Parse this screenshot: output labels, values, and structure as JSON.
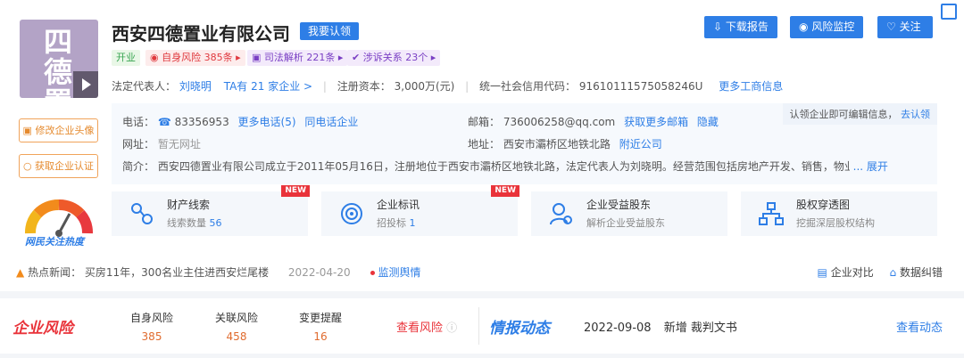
{
  "company": {
    "logo_text": "四德置业",
    "name": "西安四德置业有限公司",
    "claim_button": "我要认领",
    "status_tag": "开业",
    "risk_tag": "自身风险 385条",
    "law_tag": "司法解析 221条",
    "suit_tag": "涉诉关系 23个",
    "legal_rep_label": "法定代表人：",
    "legal_rep_name": "刘晓明",
    "legal_rep_companies": "TA有 21 家企业 >",
    "capital_label": "注册资本：",
    "capital_value": "3,000万(元)",
    "credit_code_label": "统一社会信用代码：",
    "credit_code_value": "91610111575058246U",
    "more_info": "更多工商信息"
  },
  "toolbar": {
    "download_report": "下载报告",
    "risk_monitor": "风险监控",
    "follow": "关注"
  },
  "side": {
    "modify_avatar": "修改企业头像",
    "get_cert": "获取企业认证",
    "heat_label": "网民关注热度"
  },
  "info": {
    "phone_label": "电话：",
    "phone_value": "83356953",
    "more_phone": "更多电话(5)",
    "same_phone": "同电话企业",
    "email_label": "邮箱：",
    "email_value": "736006258@qq.com",
    "more_email": "获取更多邮箱",
    "hide": "隐藏",
    "website_label": "网址：",
    "website_value": "暂无网址",
    "address_label": "地址：",
    "address_value": "西安市灞桥区地铁北路",
    "nearby": "附近公司",
    "intro_label": "简介：",
    "intro_value": "西安四德置业有限公司成立于2011年05月16日，注册地位于西安市灞桥区地铁北路，法定代表人为刘晓明。经营范围包括房地产开发、销售，物业管",
    "expand": "... 展开",
    "claim_hint": "认领企业即可编辑信息，",
    "claim_link": "去认领"
  },
  "features": [
    {
      "title": "财产线索",
      "sub": "线索数量",
      "sub_num": "56",
      "badge": "NEW"
    },
    {
      "title": "企业标讯",
      "sub": "招投标",
      "sub_num": "1",
      "badge": "NEW"
    },
    {
      "title": "企业受益股东",
      "sub": "解析企业受益股东",
      "sub_num": "",
      "badge": ""
    },
    {
      "title": "股权穿透图",
      "sub": "挖掘深层股权结构",
      "sub_num": "",
      "badge": ""
    }
  ],
  "news": {
    "label": "热点新闻：",
    "text": "买房11年，300名业主住进西安烂尾楼",
    "date": "2022-04-20",
    "monitor": "监测舆情",
    "compare": "企业对比",
    "correct": "数据纠错"
  },
  "risk": {
    "title": "企业风险",
    "self_label": "自身风险",
    "self_value": "385",
    "related_label": "关联风险",
    "related_value": "458",
    "change_label": "变更提醒",
    "change_value": "16",
    "view": "查看风险"
  },
  "intel": {
    "title": "情报动态",
    "date": "2022-09-08",
    "text": "新增 裁判文书",
    "view": "查看动态"
  },
  "colors": {
    "accent": "#2e7ee6",
    "risk": "#e9333a",
    "orange": "#e58a2e"
  }
}
